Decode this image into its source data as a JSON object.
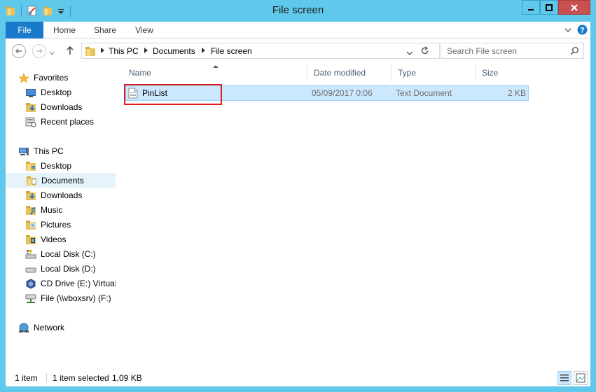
{
  "window": {
    "title": "File screen"
  },
  "ribbon": {
    "tabs": [
      {
        "label": "File"
      },
      {
        "label": "Home"
      },
      {
        "label": "Share"
      },
      {
        "label": "View"
      }
    ]
  },
  "address": {
    "crumbs": [
      "This PC",
      "Documents",
      "File screen"
    ],
    "search_placeholder": "Search File screen"
  },
  "nav": {
    "favorites": {
      "label": "Favorites",
      "items": [
        {
          "label": "Desktop",
          "icon": "desktop-icon"
        },
        {
          "label": "Downloads",
          "icon": "downloads-icon"
        },
        {
          "label": "Recent places",
          "icon": "recent-places-icon"
        }
      ]
    },
    "thispc": {
      "label": "This PC",
      "items": [
        {
          "label": "Desktop",
          "icon": "desktop-folder-icon"
        },
        {
          "label": "Documents",
          "icon": "documents-icon",
          "selected": true
        },
        {
          "label": "Downloads",
          "icon": "downloads-icon"
        },
        {
          "label": "Music",
          "icon": "music-icon"
        },
        {
          "label": "Pictures",
          "icon": "pictures-icon"
        },
        {
          "label": "Videos",
          "icon": "videos-icon"
        },
        {
          "label": "Local Disk (C:)",
          "icon": "system-drive-icon"
        },
        {
          "label": "Local Disk (D:)",
          "icon": "drive-icon"
        },
        {
          "label": "CD Drive (E:) VirtualBox Guest Additions",
          "icon": "cd-drive-icon"
        },
        {
          "label": "File (\\\\vboxsrv) (F:)",
          "icon": "network-drive-icon"
        }
      ]
    },
    "network": {
      "label": "Network"
    }
  },
  "files": {
    "columns": [
      "Name",
      "Date modified",
      "Type",
      "Size"
    ],
    "rows": [
      {
        "name": "PinList",
        "date": "05/09/2017 0:06",
        "type": "Text Document",
        "size": "2 KB",
        "selected": true
      }
    ]
  },
  "status": {
    "count": "1 item",
    "selection": "1 item selected",
    "selection_size": "1,09 KB"
  },
  "colors": {
    "titlebar": "#60C8EA",
    "file_tab": "#1979CA",
    "selection": "#CCE8FF",
    "highlight_box": "#E01B1B",
    "close_button": "#C75050"
  }
}
